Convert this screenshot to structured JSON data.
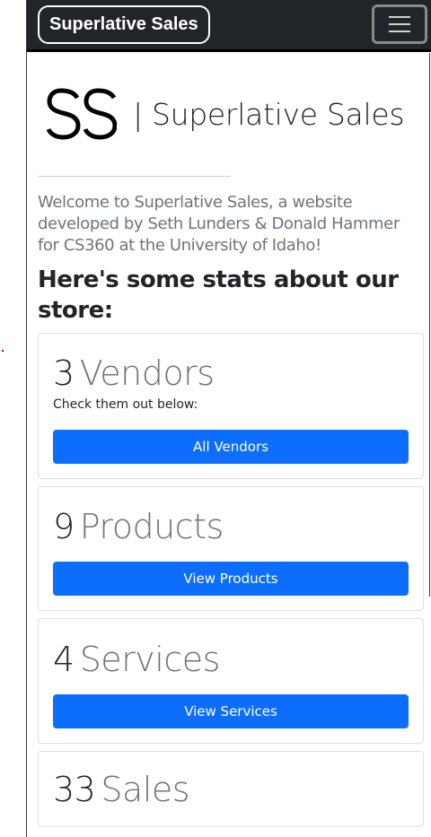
{
  "navbar": {
    "brand": "Superlative Sales",
    "toggler_icon": "hamburger-menu-icon"
  },
  "hero": {
    "logo_mark": "SS",
    "logo_text": "| Superlative Sales",
    "welcome": "Welcome to Superlative Sales, a website developed by Seth Lunders & Donald Hammer for CS360 at the University of Idaho!",
    "stats_heading": "Here's some stats about our store:"
  },
  "stats": {
    "vendors": {
      "count": "3",
      "label": "Vendors",
      "subtext": "Check them out below:",
      "button": "All Vendors"
    },
    "products": {
      "count": "9",
      "label": "Products",
      "button": "View Products"
    },
    "services": {
      "count": "4",
      "label": "Services",
      "button": "View Services"
    },
    "sales": {
      "count": "33",
      "label": "Sales"
    }
  },
  "colors": {
    "navbar_bg": "#212529",
    "primary": "#0d6efd",
    "muted": "#6c757d"
  }
}
